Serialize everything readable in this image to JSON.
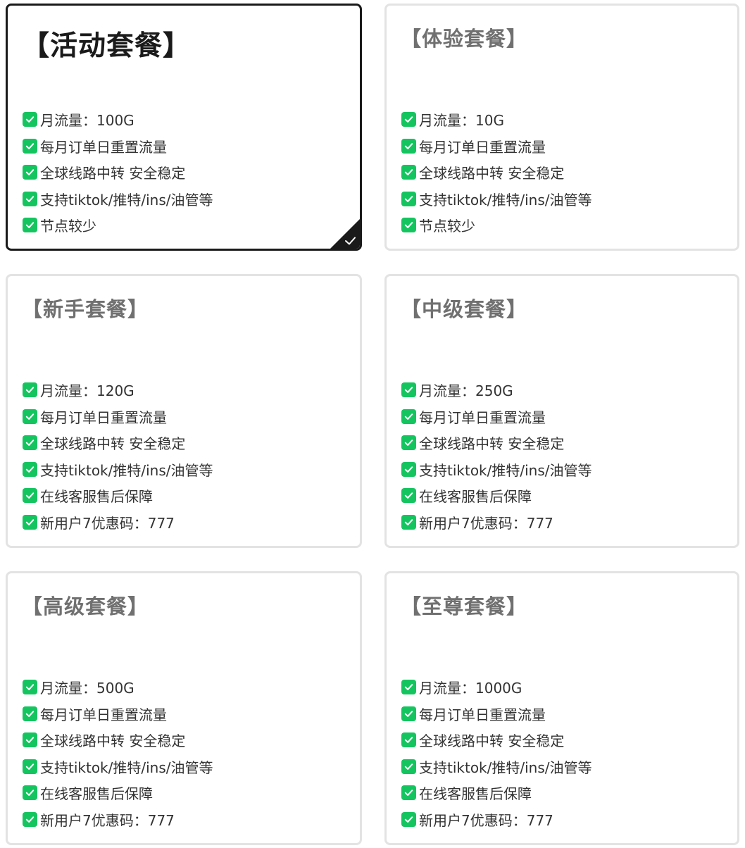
{
  "plans": [
    {
      "title": "【活动套餐】",
      "selected": true,
      "features": [
        "月流量：100G",
        "每月订单日重置流量",
        "全球线路中转 安全稳定",
        "支持tiktok/推特/ins/油管等",
        "节点较少"
      ]
    },
    {
      "title": "【体验套餐】",
      "selected": false,
      "features": [
        "月流量：10G",
        "每月订单日重置流量",
        "全球线路中转 安全稳定",
        "支持tiktok/推特/ins/油管等",
        "节点较少"
      ]
    },
    {
      "title": "【新手套餐】",
      "selected": false,
      "features": [
        "月流量：120G",
        "每月订单日重置流量",
        "全球线路中转 安全稳定",
        "支持tiktok/推特/ins/油管等",
        "在线客服售后保障",
        "新用户7优惠码：777"
      ]
    },
    {
      "title": "【中级套餐】",
      "selected": false,
      "features": [
        "月流量：250G",
        "每月订单日重置流量",
        "全球线路中转 安全稳定",
        "支持tiktok/推特/ins/油管等",
        "在线客服售后保障",
        "新用户7优惠码：777"
      ]
    },
    {
      "title": "【高级套餐】",
      "selected": false,
      "features": [
        "月流量：500G",
        "每月订单日重置流量",
        "全球线路中转 安全稳定",
        "支持tiktok/推特/ins/油管等",
        "在线客服售后保障",
        "新用户7优惠码：777"
      ]
    },
    {
      "title": "【至尊套餐】",
      "selected": false,
      "features": [
        "月流量：1000G",
        "每月订单日重置流量",
        "全球线路中转 安全稳定",
        "支持tiktok/推特/ins/油管等",
        "在线客服售后保障",
        "新用户7优惠码：777"
      ]
    }
  ],
  "icons": {
    "feature": "checkbox-checked-icon",
    "selected_corner": "selected-corner-check-icon"
  },
  "colors": {
    "check_green": "#14c55f",
    "selected_border": "#1a1a1a",
    "card_border": "#e3e3e3",
    "title_gray": "#707070",
    "feature_text": "#333333"
  }
}
